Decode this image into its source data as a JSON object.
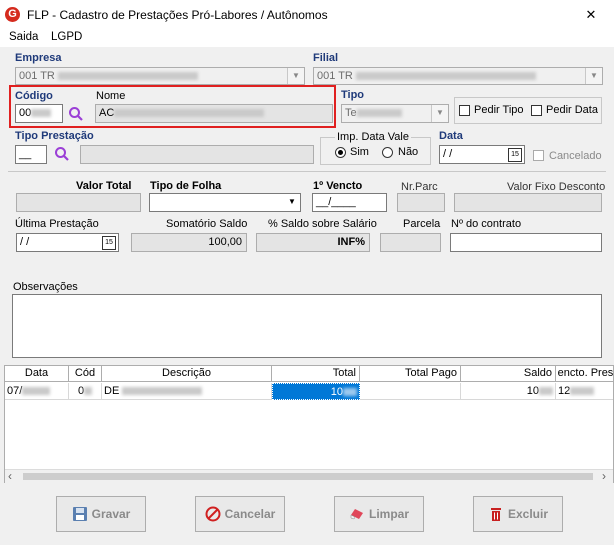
{
  "window": {
    "title": "FLP - Cadastro de Prestações Pró-Labores / Autônomos",
    "close_glyph": "✕"
  },
  "menu": [
    "Saida",
    "LGPD"
  ],
  "empresa": {
    "label": "Empresa",
    "value": "001 TR"
  },
  "filial": {
    "label": "Filial",
    "value": "001 TR"
  },
  "codigo": {
    "label": "Código",
    "value": "00"
  },
  "nome": {
    "label": "Nome",
    "value": "AC"
  },
  "tipo": {
    "label": "Tipo",
    "value": "Te"
  },
  "pedir_tipo": {
    "label": "Pedir Tipo",
    "checked": false
  },
  "pedir_data": {
    "label": "Pedir Data",
    "checked": false
  },
  "tipo_prestacao": {
    "label": "Tipo Prestação"
  },
  "imp_data_vale": {
    "label": "Imp. Data Vale",
    "options": [
      "Sim",
      "Não"
    ],
    "selected": "Sim"
  },
  "data": {
    "label": "Data",
    "value": " / /"
  },
  "cancelado": {
    "label": "Cancelado",
    "checked": false
  },
  "valor_total": {
    "label": "Valor Total"
  },
  "tipo_folha": {
    "label": "Tipo de Folha",
    "value": ""
  },
  "primeiro_vencto": {
    "label": "1º Vencto",
    "value": "__/____"
  },
  "nr_parc": {
    "label": "Nr.Parc"
  },
  "valor_fixo_desconto": {
    "label": "Valor Fixo Desconto"
  },
  "ultima_prestacao": {
    "label": "Última Prestação",
    "value": " / /"
  },
  "somatorio_saldo": {
    "label": "Somatório Saldo",
    "value": "100,00"
  },
  "pct_saldo_salario": {
    "label": "% Saldo sobre Salário",
    "value": "INF%"
  },
  "parcela": {
    "label": "Parcela"
  },
  "numero_contrato": {
    "label": "Nº do contrato"
  },
  "observacoes": {
    "label": "Observações"
  },
  "grid": {
    "columns": [
      "Data",
      "Cód",
      "Descrição",
      "Total",
      "Total Pago",
      "Saldo",
      "encto. Pres"
    ],
    "rows": [
      {
        "data": "07/",
        "cod": "0",
        "descricao": "DE",
        "total": "10",
        "total_pago": "",
        "saldo": "10",
        "vencto": "12"
      }
    ]
  },
  "scroll": {
    "left": "‹",
    "right": "›"
  },
  "buttons": {
    "gravar": "Gravar",
    "cancelar": "Cancelar",
    "limpar": "Limpar",
    "excluir": "Excluir"
  },
  "colors": {
    "red_highlight": "#e02020",
    "label_blue": "#1f3a7a",
    "selected_cell": "#0078d7",
    "app_icon": "#d52b1e"
  }
}
